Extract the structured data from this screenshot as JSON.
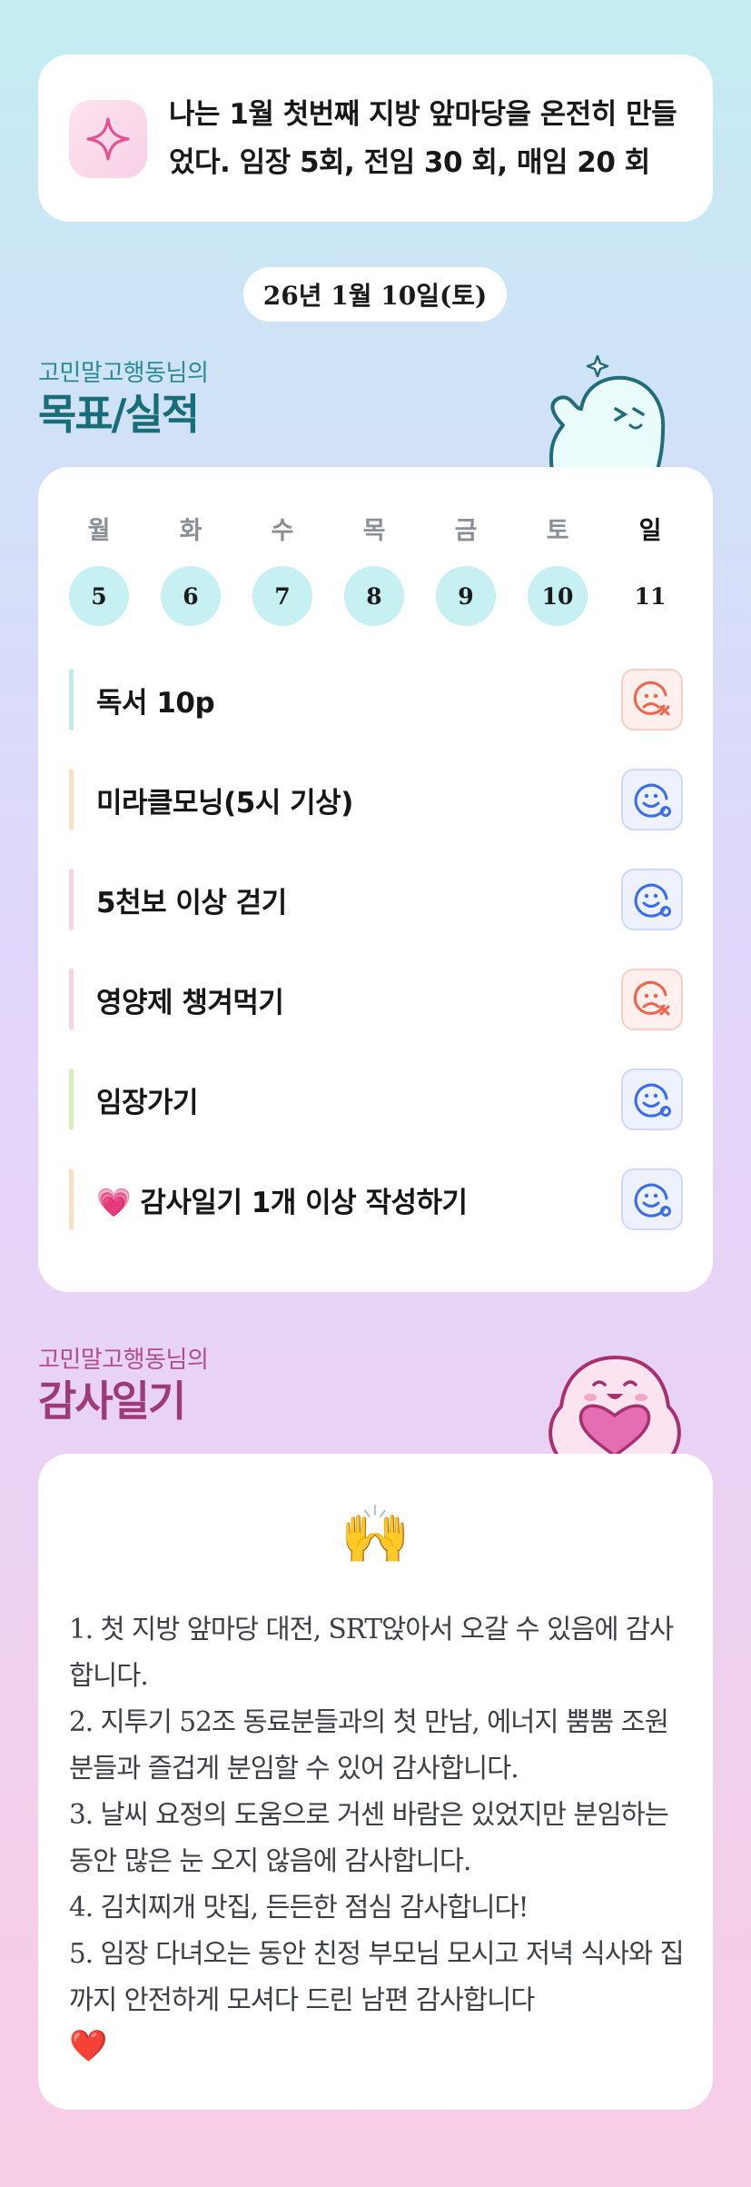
{
  "banner": {
    "icon": "sparkle-icon",
    "text": "나는 1월 첫번째 지방 앞마당을 온전히 만들었다. 임장 5회, 전임 30 회, 매임 20 회"
  },
  "date": "26년 1월 10일(토)",
  "goals_section": {
    "subtitle": "고민말고행동님의",
    "title": "목표/실적",
    "weekdays": [
      "월",
      "화",
      "수",
      "목",
      "금",
      "토",
      "일"
    ],
    "days": [
      "5",
      "6",
      "7",
      "8",
      "9",
      "10",
      "11"
    ],
    "items": [
      {
        "label": "독서 10p",
        "status": "fail",
        "bar_color": "#bdeee6"
      },
      {
        "label": "미라클모닝(5시 기상)",
        "status": "done",
        "bar_color": "#fbe0c4"
      },
      {
        "label": "5천보 이상 걷기",
        "status": "done",
        "bar_color": "#f9d2e4"
      },
      {
        "label": "영양제 챙겨먹기",
        "status": "fail",
        "bar_color": "#f9d2e4"
      },
      {
        "label": "임장가기",
        "status": "done",
        "bar_color": "#d7f0b9"
      },
      {
        "label": "💗 감사일기 1개 이상 작성하기",
        "status": "done",
        "bar_color": "#fbe0c4"
      }
    ]
  },
  "journal_section": {
    "subtitle": "고민말고행동님의",
    "title": "감사일기",
    "emoji": "🙌",
    "entries": [
      "1. 첫 지방 앞마당 대전, SRT앉아서 오갈 수 있음에 감사합니다.",
      "2. 지투기 52조 동료분들과의 첫 만남, 에너지 뿜뿜 조원분들과 즐겁게 분임할 수 있어 감사합니다.",
      "3. 날씨 요정의 도움으로 거센 바람은 있었지만 분임하는 동안 많은 눈 오지 않음에 감사합니다.",
      "4. 김치찌개 맛집, 든든한 점심 감사합니다!",
      "5. 임장 다녀오는 동안 친정 부모님 모시고 저녁 식사와 집까지 안전하게 모셔다 드린 남편 감사합니다"
    ],
    "closing_emoji": "❤️"
  },
  "colors": {
    "teal_title": "#186e78",
    "plum_title": "#9c3a7a",
    "day_circle": "#c7f0f3",
    "fail": "#f0624c",
    "done": "#3a6cf0"
  }
}
